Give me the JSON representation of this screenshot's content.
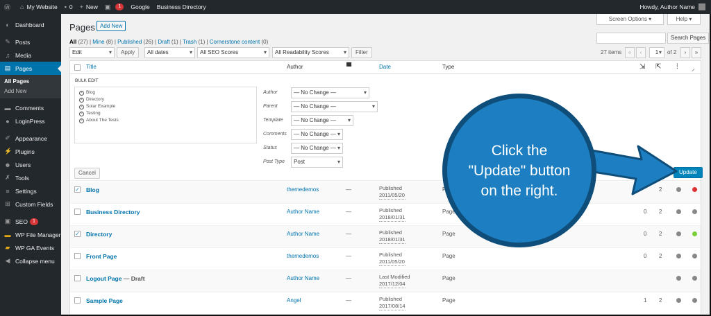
{
  "adminbar": {
    "site_name": "My Website",
    "comments_count": "0",
    "new_label": "New",
    "seo_badge": "1",
    "google_label": "Google",
    "business_label": "Business Directory",
    "howdy": "Howdy, Author Name"
  },
  "sidebar": {
    "items": [
      {
        "label": "Dashboard",
        "icon": "dashboard-icon"
      },
      {
        "label": "Posts",
        "icon": "pin-icon"
      },
      {
        "label": "Media",
        "icon": "media-icon"
      },
      {
        "label": "Pages",
        "icon": "pages-icon"
      },
      {
        "label": "Comments",
        "icon": "comment-icon"
      },
      {
        "label": "LoginPress",
        "icon": "loginpress-icon"
      },
      {
        "label": "Appearance",
        "icon": "brush-icon"
      },
      {
        "label": "Plugins",
        "icon": "plugin-icon"
      },
      {
        "label": "Users",
        "icon": "users-icon"
      },
      {
        "label": "Tools",
        "icon": "wrench-icon"
      },
      {
        "label": "Settings",
        "icon": "settings-icon"
      },
      {
        "label": "Custom Fields",
        "icon": "custom-fields-icon"
      },
      {
        "label": "SEO",
        "icon": "seo-icon",
        "badge": "1"
      },
      {
        "label": "WP File Manager",
        "icon": "folder-icon"
      },
      {
        "label": "WP GA Events",
        "icon": "ga-icon"
      },
      {
        "label": "Collapse menu",
        "icon": "collapse-icon"
      }
    ],
    "submenu": [
      "All Pages",
      "Add New"
    ]
  },
  "header": {
    "screen_options": "Screen Options ▾",
    "help": "Help ▾",
    "title": "Pages",
    "add_new": "Add New"
  },
  "views": {
    "all": "All",
    "all_count": "(27)",
    "mine": "Mine",
    "mine_count": "(8)",
    "published": "Published",
    "published_count": "(26)",
    "draft": "Draft",
    "draft_count": "(1)",
    "trash": "Trash",
    "trash_count": "(1)",
    "cornerstone": "Cornerstone content",
    "cornerstone_count": "(0)",
    "sep": "|"
  },
  "toolbar": {
    "search_button": "Search Pages",
    "bulk_action": "Edit",
    "apply": "Apply",
    "dates": "All dates",
    "seo_scores": "All SEO Scores",
    "readability": "All Readability Scores",
    "filter": "Filter",
    "items": "27 items",
    "first": "«",
    "prev": "‹",
    "current_page": "1",
    "of_pages": "of 2",
    "next": "›",
    "last": "»"
  },
  "columns": {
    "title": "Title",
    "author": "Author",
    "date": "Date",
    "type": "Type"
  },
  "bulk_edit": {
    "heading": "BULK EDIT",
    "pages": [
      "Blog",
      "Directory",
      "Solar Example",
      "Testing",
      "About The Tests"
    ],
    "fields": [
      {
        "label": "Author",
        "value": "— No Change —"
      },
      {
        "label": "Parent",
        "value": "— No Change —"
      },
      {
        "label": "Template",
        "value": "— No Change —"
      },
      {
        "label": "Comments",
        "value": "— No Change —"
      },
      {
        "label": "Status",
        "value": "— No Change —"
      },
      {
        "label": "Post Type",
        "value": "Post"
      }
    ],
    "cancel": "Cancel",
    "update": "Update"
  },
  "rows": [
    {
      "title": "Blog",
      "status": "",
      "author": "themedemos",
      "comments": "—",
      "date_status": "Published",
      "date": "2011/05/20",
      "type": "Page",
      "n1": "",
      "n2": "2",
      "checked": true,
      "dot1": "#888888",
      "dot2": "#dc3232"
    },
    {
      "title": "Business Directory",
      "status": "",
      "author": "Author Name",
      "comments": "—",
      "date_status": "Published",
      "date": "2018/01/31",
      "type": "Page",
      "n1": "0",
      "n2": "2",
      "checked": false,
      "dot1": "#888888",
      "dot2": "#888888"
    },
    {
      "title": "Directory",
      "status": "",
      "author": "Author Name",
      "comments": "—",
      "date_status": "Published",
      "date": "2018/01/31",
      "type": "Page",
      "n1": "0",
      "n2": "2",
      "checked": true,
      "dot1": "#888888",
      "dot2": "#7ad03a"
    },
    {
      "title": "Front Page",
      "status": "",
      "author": "themedemos",
      "comments": "—",
      "date_status": "Published",
      "date": "2011/05/20",
      "type": "Page",
      "n1": "0",
      "n2": "2",
      "checked": false,
      "dot1": "#888888",
      "dot2": "#888888"
    },
    {
      "title": "Logout Page",
      "status": "— Draft",
      "author": "Author Name",
      "comments": "—",
      "date_status": "Last Modified",
      "date": "2017/12/04",
      "type": "Page",
      "n1": "",
      "n2": "",
      "checked": false,
      "dot1": "#888888",
      "dot2": "#888888"
    },
    {
      "title": "Sample Page",
      "status": "",
      "author": "Angel",
      "comments": "—",
      "date_status": "Published",
      "date": "2017/08/14",
      "type": "Page",
      "n1": "1",
      "n2": "2",
      "checked": false,
      "dot1": "#888888",
      "dot2": "#888888"
    }
  ],
  "callout": {
    "line1": "Click the",
    "line2": "\"Update\" button",
    "line3": "on the right.",
    "fill": "#1d7fc1"
  }
}
